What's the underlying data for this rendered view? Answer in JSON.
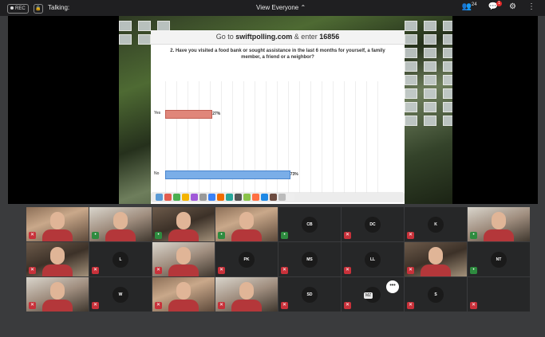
{
  "topbar": {
    "rec_label": "REC",
    "talking_label": "Talking:",
    "view_label": "View Everyone",
    "participants_count": "24",
    "chat_badge": "1"
  },
  "share": {
    "header_prefix": "Go to ",
    "header_site": "swiftpolling.com",
    "header_middle": " & enter ",
    "header_code": "16856",
    "question": "2. Have you visited a food bank or sought assistance in the last 6 months for yourself, a family member, a friend or a neighbor?"
  },
  "chart_data": {
    "type": "bar",
    "orientation": "horizontal",
    "categories": [
      "Yes",
      "No"
    ],
    "values": [
      27,
      73
    ],
    "value_labels": [
      "27%",
      "73%"
    ],
    "colors": [
      "#e0867a",
      "#7aaee8"
    ],
    "xlim": [
      0,
      100
    ]
  },
  "participants": [
    {
      "initials": "",
      "kind": "video",
      "muted": true
    },
    {
      "initials": "",
      "kind": "video",
      "muted": false
    },
    {
      "initials": "",
      "kind": "video",
      "muted": false
    },
    {
      "initials": "",
      "kind": "video",
      "muted": false
    },
    {
      "initials": "CB",
      "kind": "avatar",
      "muted": false
    },
    {
      "initials": "DC",
      "kind": "avatar",
      "muted": true
    },
    {
      "initials": "K",
      "kind": "avatar",
      "muted": true
    },
    {
      "initials": "",
      "kind": "video",
      "muted": false
    },
    {
      "initials": "",
      "kind": "video",
      "muted": true
    },
    {
      "initials": "L",
      "kind": "avatar",
      "muted": true
    },
    {
      "initials": "",
      "kind": "video",
      "muted": true
    },
    {
      "initials": "PK",
      "kind": "avatar",
      "muted": true
    },
    {
      "initials": "MS",
      "kind": "avatar",
      "muted": true
    },
    {
      "initials": "LL",
      "kind": "avatar",
      "muted": true
    },
    {
      "initials": "",
      "kind": "video",
      "muted": true
    },
    {
      "initials": "NT",
      "kind": "avatar",
      "muted": false
    },
    {
      "initials": "",
      "kind": "video",
      "muted": true
    },
    {
      "initials": "W",
      "kind": "avatar",
      "muted": true
    },
    {
      "initials": "",
      "kind": "video",
      "muted": true
    },
    {
      "initials": "",
      "kind": "video",
      "muted": true
    },
    {
      "initials": "SD",
      "kind": "avatar",
      "muted": true
    },
    {
      "initials": "",
      "kind": "avatar",
      "muted": true
    },
    {
      "initials": "S",
      "kind": "avatar",
      "muted": true
    },
    {
      "initials": "",
      "kind": "blank",
      "muted": true
    }
  ],
  "overlay": {
    "name_chip": "MZ",
    "more_glyph": "•••"
  }
}
